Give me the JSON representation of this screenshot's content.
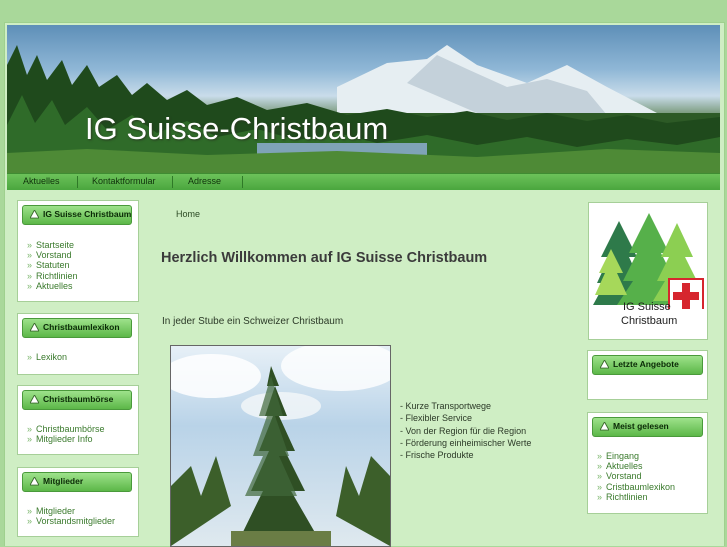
{
  "site": {
    "title": "IG Suisse-Christbaum"
  },
  "nav": {
    "items": [
      "Aktuelles",
      "Kontaktformular",
      "Adresse"
    ]
  },
  "sidebar_left": [
    {
      "title": "IG Suisse Christbaum",
      "links": [
        "Startseite",
        "Vorstand",
        "Statuten",
        "Richtlinien",
        "Aktuelles"
      ]
    },
    {
      "title": "Christbaumlexikon",
      "links": [
        "Lexikon"
      ]
    },
    {
      "title": "Christbaumbörse",
      "links": [
        "Christbaumbörse",
        "Mitglieder Info"
      ]
    },
    {
      "title": "Mitglieder",
      "links": [
        "Mitglieder",
        "Vorstandsmitglieder"
      ]
    }
  ],
  "breadcrumb": "Home",
  "main": {
    "heading": "Herzlich Willkommen auf IG Suisse Christbaum",
    "intro": "In jeder Stube ein Schweizer Christbaum",
    "bullets": [
      "- Kurze Transportwege",
      "- Flexibler Service",
      "- Von der Region für die Region",
      "- Förderung einheimischer Werte",
      "- Frische Produkte"
    ]
  },
  "logo": {
    "line1": "IG Suisse",
    "line2": "Christbaum"
  },
  "sidebar_right": [
    {
      "title": "Letzte Angebote",
      "links": []
    },
    {
      "title": "Meist gelesen",
      "links": [
        "Eingang",
        "Aktuelles",
        "Vorstand",
        "Cristbaumlexikon",
        "Richtlinien"
      ]
    }
  ],
  "colors": {
    "accent": "#5cb748",
    "link": "#3a7a2c",
    "background": "#a9d89a"
  }
}
